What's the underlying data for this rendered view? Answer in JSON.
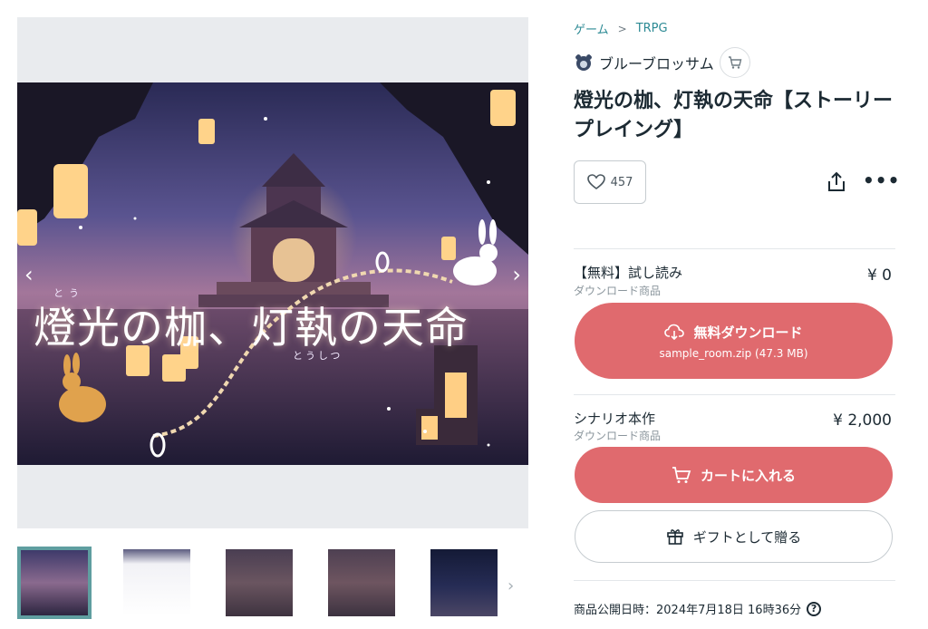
{
  "breadcrumb": {
    "items": [
      "ゲーム",
      "TRPG"
    ],
    "separator": ">"
  },
  "shop": {
    "name": "ブルーブロッサム",
    "avatar_icon": "bear-avatar-icon",
    "cart_icon": "cart-icon"
  },
  "product": {
    "title": "燈光の枷、灯執の天命【ストーリープレイング】",
    "likes": "457",
    "artwork_title": "燈光の枷、灯執の天命",
    "artwork_ruby_1": "とう",
    "artwork_ruby_2": "とうしつ"
  },
  "gallery": {
    "thumbnail_count": 5,
    "active_index": 0,
    "prev_arrow": "‹",
    "next_arrow": "›"
  },
  "variants": [
    {
      "name": "【無料】試し読み",
      "type": "ダウンロード商品",
      "price": "¥ 0",
      "button_label": "無料ダウンロード",
      "button_sub": "sample_room.zip (47.3 MB)",
      "button_icon": "cloud-download-icon"
    },
    {
      "name": "シナリオ本作",
      "type": "ダウンロード商品",
      "price": "¥ 2,000",
      "button_label": "カートに入れる",
      "button_icon": "cart-icon"
    }
  ],
  "gift": {
    "label": "ギフトとして贈る",
    "icon": "gift-icon"
  },
  "published": {
    "label": "商品公開日時：2024年7月18日 16時36分",
    "icon": "help-icon"
  },
  "colors": {
    "accent": "#e06a6e",
    "link": "#2c8a94",
    "thumb_border": "#5f9ea0"
  }
}
